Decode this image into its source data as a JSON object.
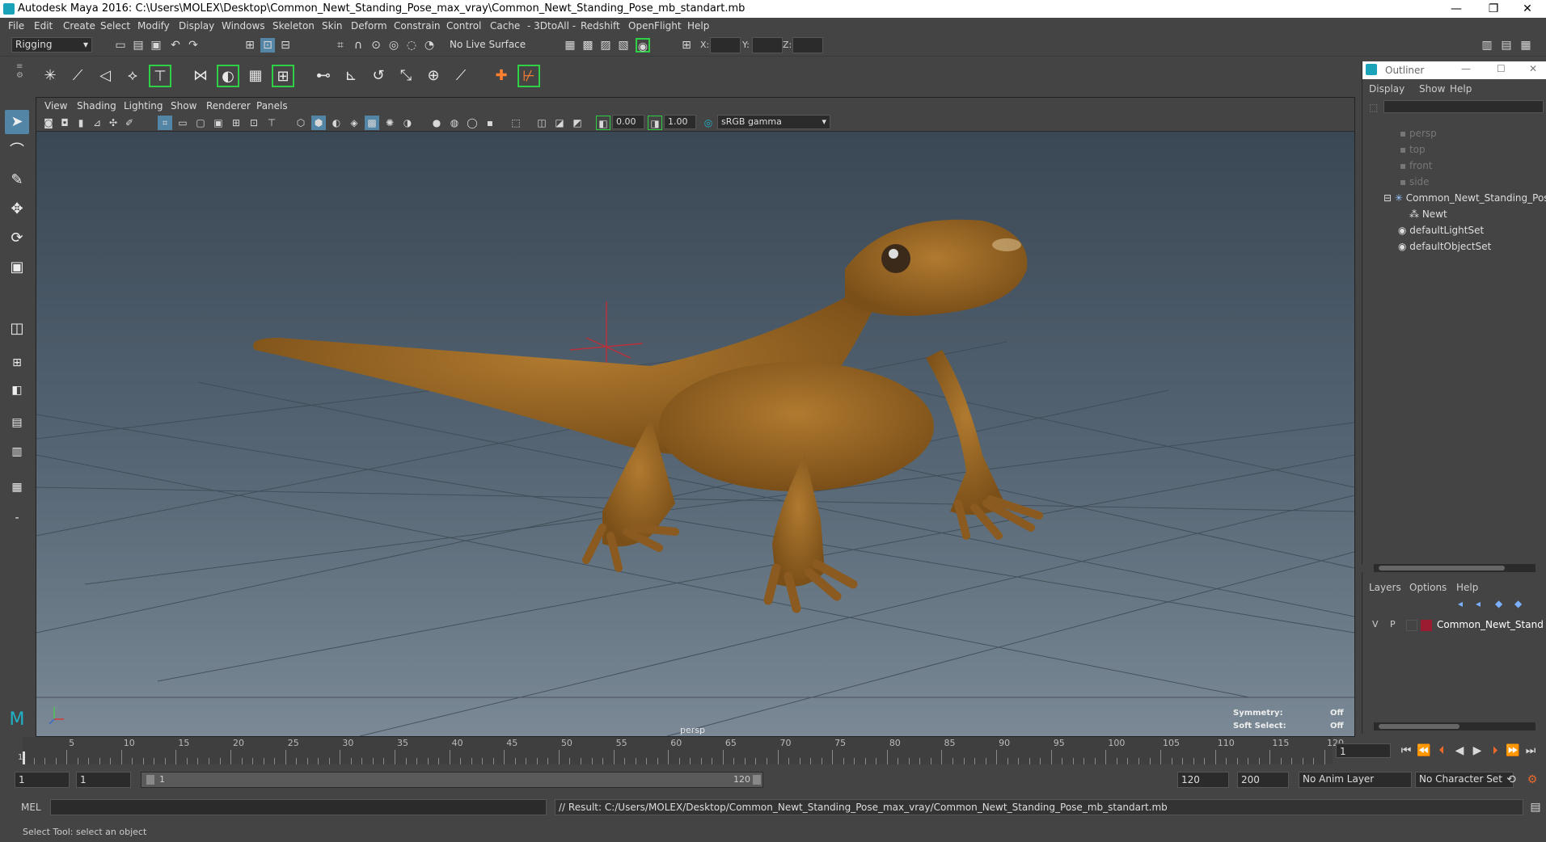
{
  "window": {
    "title": "Autodesk Maya 2016: C:\\Users\\MOLEX\\Desktop\\Common_Newt_Standing_Pose_max_vray\\Common_Newt_Standing_Pose_mb_standart.mb",
    "min": "—",
    "max": "❐",
    "close": "✕"
  },
  "menu": [
    "File",
    "Edit",
    "Create",
    "Select",
    "Modify",
    "Display",
    "Windows",
    "Skeleton",
    "Skin",
    "Deform",
    "Constrain",
    "Control",
    "Cache",
    "- 3DtoAll -",
    "Redshift",
    "OpenFlight",
    "Help"
  ],
  "toolbar": {
    "mode": "Rigging",
    "live_surface": "No Live Surface",
    "x_label": "X:",
    "y_label": "Y:",
    "z_label": "Z:"
  },
  "panel": {
    "menu": [
      "View",
      "Shading",
      "Lighting",
      "Show",
      "Renderer",
      "Panels"
    ],
    "exposure": "0.00",
    "gamma": "1.00",
    "colorspace": "sRGB gamma"
  },
  "viewport": {
    "camera_label": "persp",
    "symmetry_label": "Symmetry:",
    "symmetry_value": "Off",
    "softselect_label": "Soft Select:",
    "softselect_value": "Off"
  },
  "outliner": {
    "title": "Outliner",
    "menu": [
      "Display",
      "Show",
      "Help"
    ],
    "items": [
      {
        "label": "persp"
      },
      {
        "label": "top"
      },
      {
        "label": "front"
      },
      {
        "label": "side"
      },
      {
        "label": "Common_Newt_Standing_Pose"
      },
      {
        "label": "Newt"
      },
      {
        "label": "defaultLightSet"
      },
      {
        "label": "defaultObjectSet"
      }
    ]
  },
  "layers": {
    "menu": [
      "Layers",
      "Options",
      "Help"
    ],
    "row": {
      "v": "V",
      "p": "P",
      "name": "Common_Newt_Stand",
      "color": "#9b1b30"
    }
  },
  "timeline": {
    "ticks": [
      "5",
      "10",
      "15",
      "20",
      "25",
      "30",
      "35",
      "40",
      "45",
      "50",
      "55",
      "60",
      "65",
      "70",
      "75",
      "80",
      "85",
      "90",
      "95",
      "100",
      "105",
      "110",
      "115",
      "120"
    ],
    "start_marker": "1",
    "current": "1"
  },
  "range": {
    "start": "1",
    "start2": "1",
    "slider_start": "1",
    "slider_end": "120",
    "end": "120",
    "end2": "200",
    "anim_layer": "No Anim Layer",
    "char_set": "No Character Set"
  },
  "cmd": {
    "lang": "MEL",
    "result": "// Result: C:/Users/MOLEX/Desktop/Common_Newt_Standing_Pose_max_vray/Common_Newt_Standing_Pose_mb_standart.mb"
  },
  "help": {
    "text": "Select Tool: select an object"
  }
}
